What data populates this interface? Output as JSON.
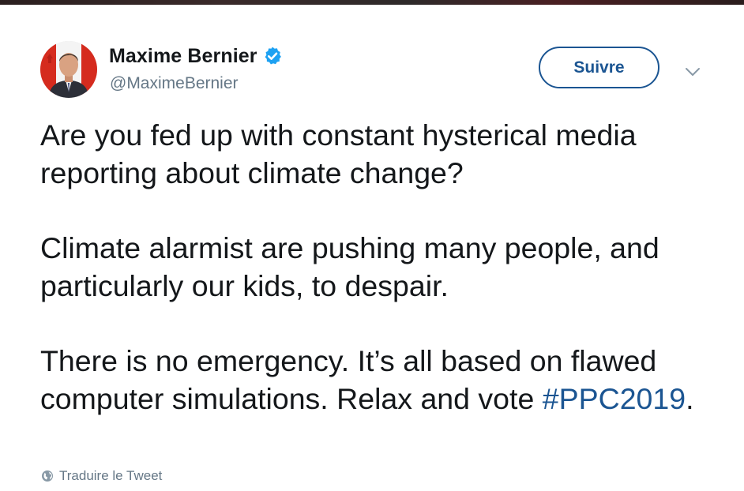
{
  "tweet": {
    "author": {
      "display_name": "Maxime Bernier",
      "handle": "@MaximeBernier",
      "verified": true,
      "avatar_icon": "profile-photo-with-canadian-flag"
    },
    "follow_label": "Suivre",
    "more_icon": "chevron-down-icon",
    "text": {
      "p1": "Are you fed up with constant hysterical media reporting about climate change?",
      "p2": "Climate alarmist are pushing many people, and particularly our kids, to despair.",
      "p3_before_hashtag": "There is no emergency. It’s all based on flawed computer simulations. Relax and vote ",
      "hashtag": "#PPC2019",
      "p3_after_hashtag": "."
    },
    "translate_label": "Traduire le Tweet",
    "translate_icon": "globe-icon"
  },
  "colors": {
    "accent_blue": "#1b5592",
    "verified_blue": "#1da1f2",
    "text_primary": "#14171a",
    "text_secondary": "#657786"
  }
}
